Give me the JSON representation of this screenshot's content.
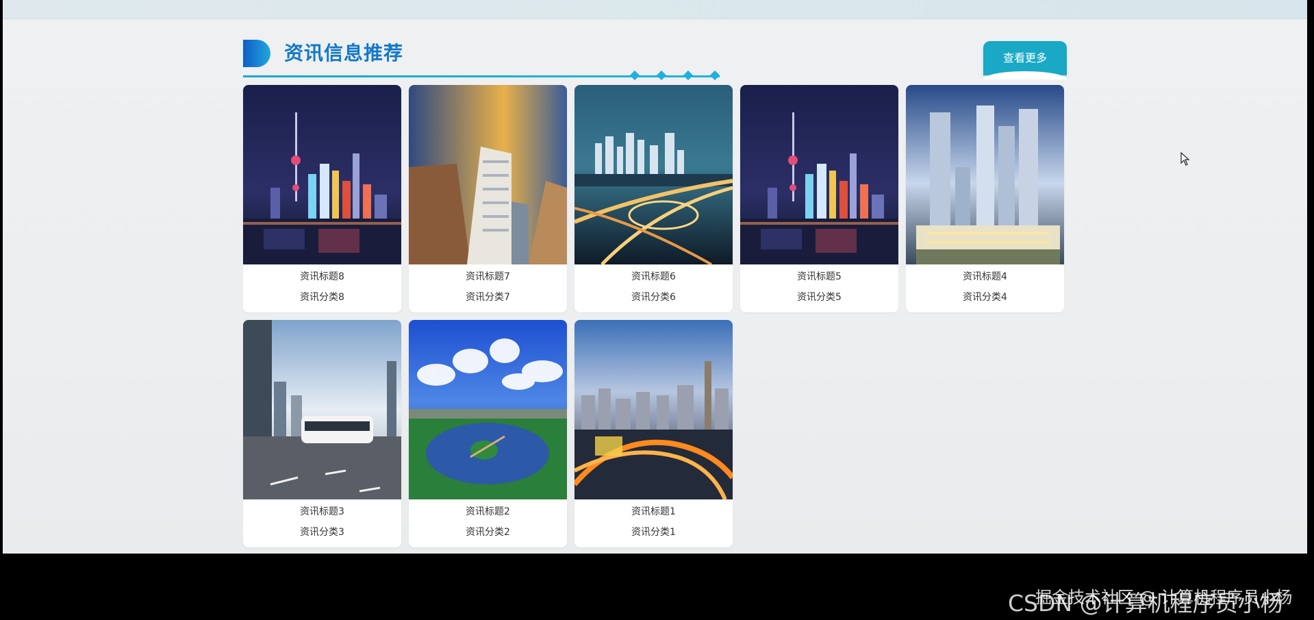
{
  "section": {
    "title": "资讯信息推荐",
    "more_label": "查看更多"
  },
  "colors": {
    "accent": "#1378c8",
    "button": "#19a9c6",
    "line": "#1ba5d8"
  },
  "items": [
    {
      "title": "资讯标题8",
      "category": "资讯分类8",
      "scene": "night-skyline-tower"
    },
    {
      "title": "资讯标题7",
      "category": "资讯分类7",
      "scene": "skyscraper-upview"
    },
    {
      "title": "资讯标题6",
      "category": "资讯分类6",
      "scene": "night-interchange"
    },
    {
      "title": "资讯标题5",
      "category": "资讯分类5",
      "scene": "night-skyline-tower"
    },
    {
      "title": "资讯标题4",
      "category": "资讯分类4",
      "scene": "towers-complex"
    },
    {
      "title": "资讯标题3",
      "category": "资讯分类3",
      "scene": "tram-street"
    },
    {
      "title": "资讯标题2",
      "category": "资讯分类2",
      "scene": "lake-park"
    },
    {
      "title": "资讯标题1",
      "category": "资讯分类1",
      "scene": "evening-overpass"
    }
  ],
  "watermark": {
    "text": "CSDN @计算机程序员小杨",
    "overlay": "掘金技术社区 @ 计算机程序员小杨"
  },
  "icons": [
    "mouse-cursor-icon",
    "title-decoration-icon"
  ]
}
